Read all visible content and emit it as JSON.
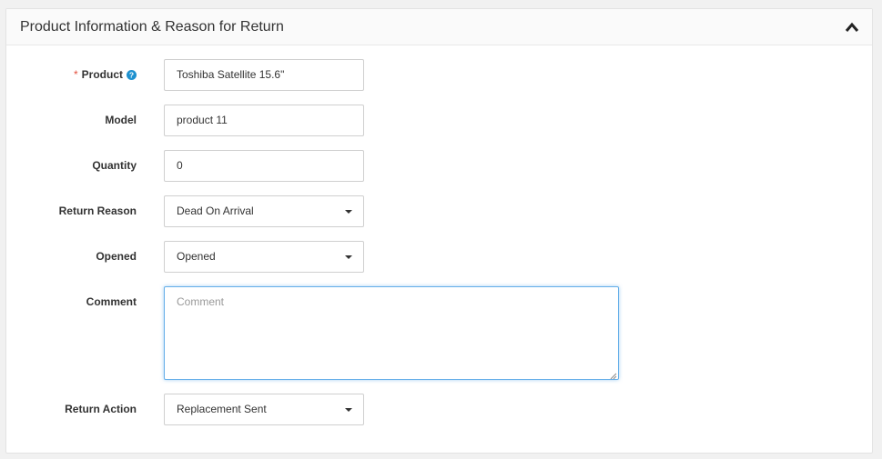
{
  "panel": {
    "title": "Product Information & Reason for Return",
    "collapse_icon": "chevron-up-icon"
  },
  "form": {
    "product": {
      "required_mark": "*",
      "label": "Product",
      "help_icon": "question-circle-icon",
      "value": "Toshiba Satellite 15.6\""
    },
    "model": {
      "label": "Model",
      "value": "product 11"
    },
    "quantity": {
      "label": "Quantity",
      "value": "0"
    },
    "return_reason": {
      "label": "Return Reason",
      "value": "Dead On Arrival"
    },
    "opened": {
      "label": "Opened",
      "value": "Opened"
    },
    "comment": {
      "label": "Comment",
      "placeholder": "Comment"
    },
    "return_action": {
      "label": "Return Action",
      "value": "Replacement Sent"
    }
  },
  "colors": {
    "required": "#e3503e",
    "help_icon": "#1e91cf",
    "focus_border": "#66afe9"
  }
}
